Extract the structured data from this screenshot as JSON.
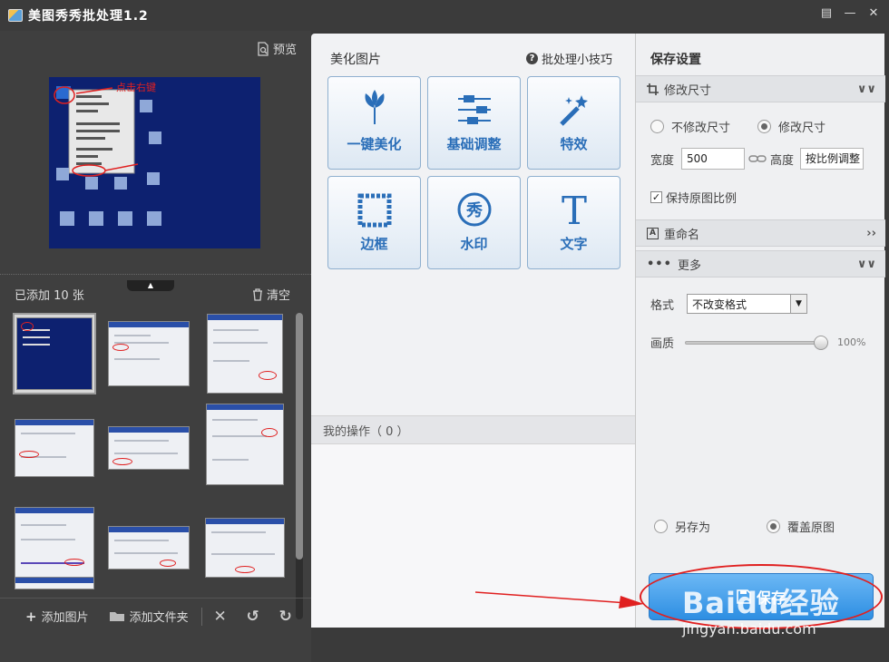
{
  "window": {
    "title": "美图秀秀批处理1.2"
  },
  "left": {
    "preview_label": "预览",
    "added_count": "已添加 10 张",
    "clear_label": "清空",
    "preview_annotation": "点击右键",
    "toolbar": {
      "add_image": "添加图片",
      "add_folder": "添加文件夹"
    }
  },
  "center": {
    "section_title": "美化图片",
    "tips_label": "批处理小技巧",
    "effects": [
      {
        "label": "一键美化",
        "icon": "tulip-icon"
      },
      {
        "label": "基础调整",
        "icon": "sliders-icon"
      },
      {
        "label": "特效",
        "icon": "magic-wand-icon"
      },
      {
        "label": "边框",
        "icon": "frame-icon"
      },
      {
        "label": "水印",
        "icon": "watermark-icon"
      },
      {
        "label": "文字",
        "icon": "text-icon"
      }
    ],
    "watermark_glyph": "秀",
    "text_glyph": "T",
    "my_ops_label": "我的操作（ 0 ）"
  },
  "right": {
    "title": "保存设置",
    "resize": {
      "header": "修改尺寸",
      "option_keep": "不修改尺寸",
      "option_change": "修改尺寸",
      "selected": "修改尺寸",
      "width_label": "宽度",
      "width_value": "500",
      "height_label": "高度",
      "height_value": "按比例调整",
      "keep_ratio_label": "保持原图比例",
      "keep_ratio_checked": true
    },
    "rename": {
      "header": "重命名"
    },
    "more": {
      "header": "更多",
      "format_label": "格式",
      "format_value": "不改变格式",
      "quality_label": "画质",
      "quality_value": "100%",
      "quality_fraction": 1.0
    },
    "save_options": {
      "save_as": "另存为",
      "overwrite": "覆盖原图",
      "selected": "覆盖原图"
    },
    "save_button": "保存"
  },
  "watermark": {
    "brand": "Baidu经验",
    "url": "jingyan.baidu.com"
  },
  "colors": {
    "accent_blue": "#2a6eb8",
    "annotation_red": "#e02020",
    "dark_bg": "#3f3f3f",
    "panel_bg": "#f1f2f4"
  }
}
